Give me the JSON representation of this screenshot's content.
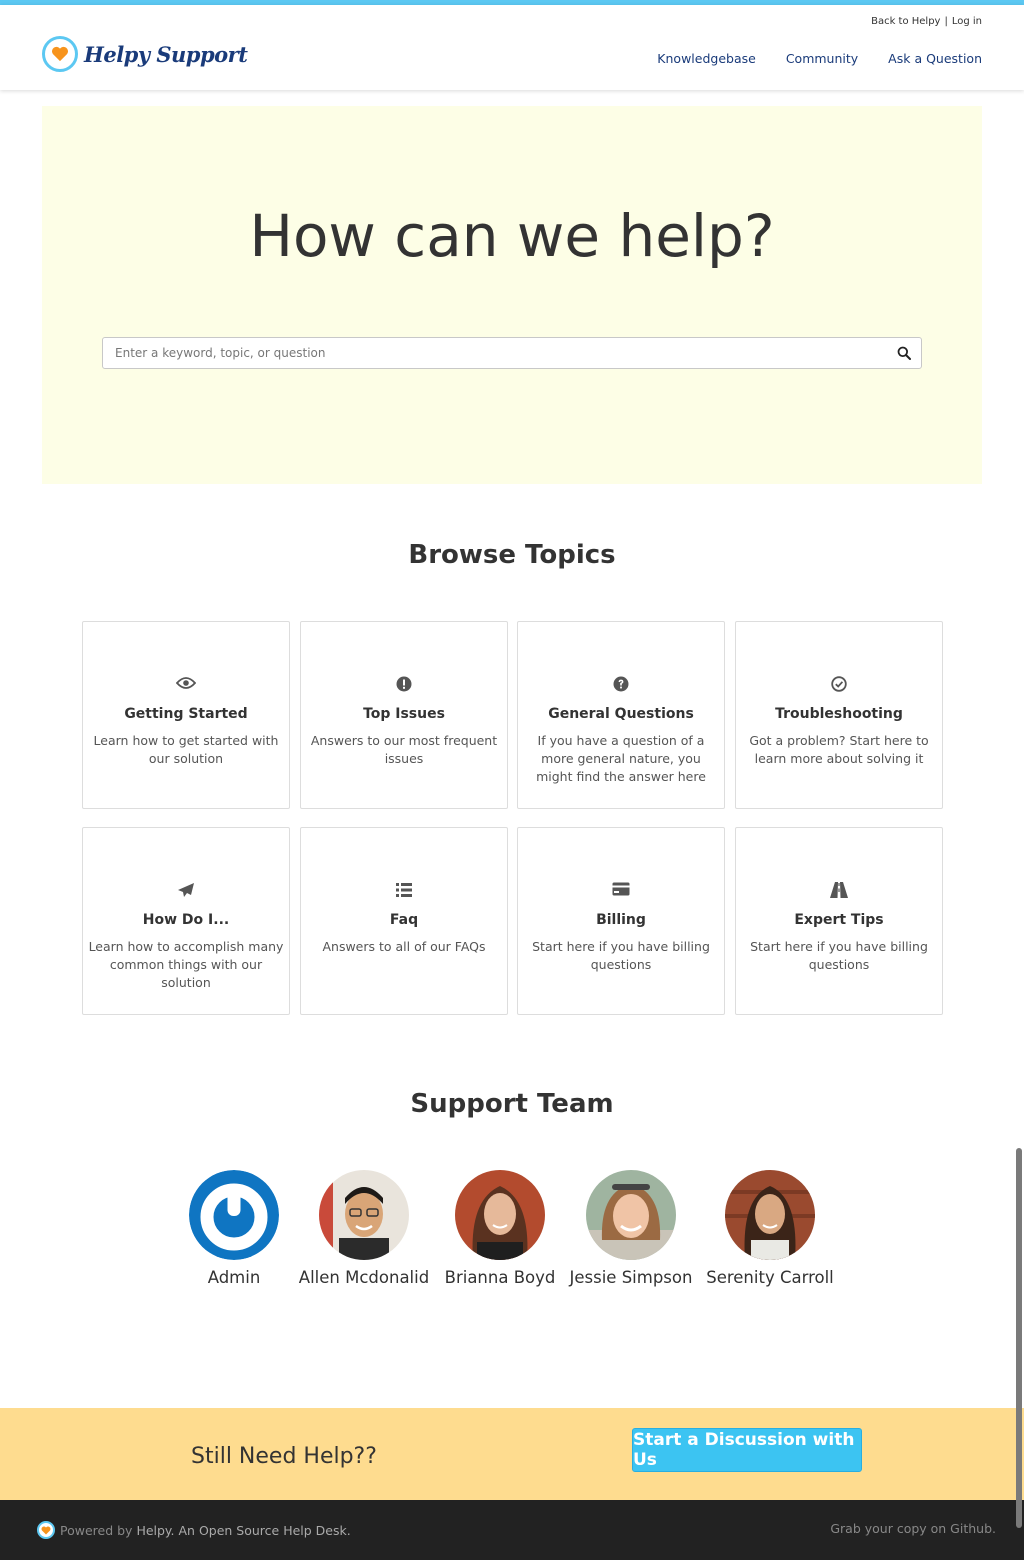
{
  "header": {
    "logo_text": "Helpy Support",
    "util_links": [
      "Back to Helpy",
      "Log in"
    ],
    "util_separator": "|",
    "nav": [
      "Knowledgebase",
      "Community",
      "Ask a Question"
    ]
  },
  "hero": {
    "title": "How can we help?",
    "search_placeholder": "Enter a keyword, topic, or question"
  },
  "browse": {
    "title": "Browse Topics",
    "topics": [
      {
        "name": "Getting Started",
        "desc": "Learn how to get started with our solution",
        "icon": "eye-icon"
      },
      {
        "name": "Top Issues",
        "desc": "Answers to our most frequent issues",
        "icon": "exclamation-circle-icon"
      },
      {
        "name": "General Questions",
        "desc": "If you have a question of a more general nature, you might find the answer here",
        "icon": "question-circle-icon"
      },
      {
        "name": "Troubleshooting",
        "desc": "Got a problem? Start here to learn more about solving it",
        "icon": "check-circle-icon"
      },
      {
        "name": "How Do I...",
        "desc": "Learn how to accomplish many common things with our solution",
        "icon": "paper-plane-icon"
      },
      {
        "name": "Faq",
        "desc": "Answers to all of our FAQs",
        "icon": "list-icon"
      },
      {
        "name": "Billing",
        "desc": "Start here if you have billing questions",
        "icon": "credit-card-icon"
      },
      {
        "name": "Expert Tips",
        "desc": "Start here if you have billing questions",
        "icon": "road-icon"
      }
    ]
  },
  "team": {
    "title": "Support Team",
    "members": [
      "Admin",
      "Allen Mcdonalid",
      "Brianna Boyd",
      "Jessie Simpson",
      "Serenity Carroll"
    ]
  },
  "cta": {
    "text": "Still Need Help??",
    "button": "Start a Discussion with Us"
  },
  "footer": {
    "powered_prefix": "Powered by ",
    "powered_brand": "Helpy. An Open Source Help Desk.",
    "right": "Grab your copy on Github."
  },
  "colors": {
    "accent": "#5cc8f2",
    "brand": "#1a3b7a",
    "hero_bg": "#fdfee6",
    "cta_bg": "#fedc8f",
    "button": "#3cc4f2",
    "footer_bg": "#222222",
    "heart": "#f7941d"
  }
}
